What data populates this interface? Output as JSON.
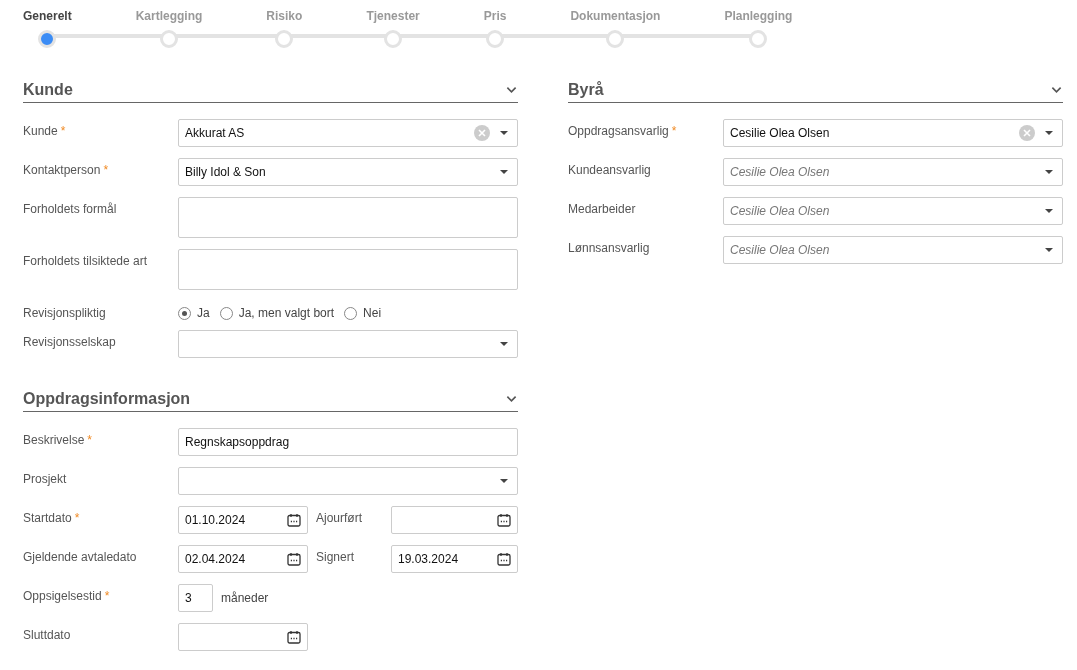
{
  "steps": [
    {
      "label": "Generelt",
      "selected": true
    },
    {
      "label": "Kartlegging",
      "selected": false
    },
    {
      "label": "Risiko",
      "selected": false
    },
    {
      "label": "Tjenester",
      "selected": false
    },
    {
      "label": "Pris",
      "selected": false
    },
    {
      "label": "Dokumentasjon",
      "selected": false
    },
    {
      "label": "Planlegging",
      "selected": false
    }
  ],
  "left_column": {
    "sections": [
      {
        "title": "Kunde",
        "fields": [
          {
            "kind": "select",
            "label": "Kunde",
            "mark": "*",
            "value": "Akkurat AS",
            "clearable": true
          },
          {
            "kind": "select",
            "label": "Kontaktperson",
            "mark": "*",
            "value": "Billy Idol & Son",
            "clearable": false
          },
          {
            "kind": "textarea",
            "label": "Forholdets formål"
          },
          {
            "kind": "textarea",
            "label": "Forholdets tilsiktede art"
          },
          {
            "kind": "radio",
            "label": "Revisjonspliktig",
            "options": [
              {
                "label": "Ja",
                "selected": true
              },
              {
                "label": "Ja, men valgt bort",
                "selected": false
              },
              {
                "label": "Nei",
                "selected": false
              }
            ]
          },
          {
            "kind": "select",
            "label": "Revisjonsselskap",
            "clearable": false
          }
        ]
      },
      {
        "title": "Oppdragsinformasjon",
        "fields": [
          {
            "kind": "text",
            "label": "Beskrivelse",
            "mark": "*",
            "value": "Regnskapsoppdrag"
          },
          {
            "kind": "select",
            "label": "Prosjekt",
            "clearable": false
          },
          {
            "kind": "date",
            "label": "Startdato",
            "mark": "*",
            "value": "01.10.2024",
            "side": {
              "label": "Ajourført"
            }
          },
          {
            "kind": "date",
            "label": "Gjeldende avtaledato",
            "value": "02.04.2024",
            "side": {
              "label": "Signert",
              "value": "19.03.2024"
            }
          },
          {
            "kind": "number",
            "label": "Oppsigelsestid",
            "mark": "*",
            "value": "3",
            "unit": "måneder"
          },
          {
            "kind": "date",
            "label": "Sluttdato"
          }
        ]
      }
    ]
  },
  "right_column": {
    "sections": [
      {
        "title": "Byrå",
        "fields": [
          {
            "kind": "select",
            "label": "Oppdragsansvarlig",
            "mark": "*",
            "value": "Cesilie Olea Olsen",
            "clearable": true
          },
          {
            "kind": "select",
            "label": "Kundeansvarlig",
            "placeholder": "Cesilie Olea Olsen",
            "clearable": false
          },
          {
            "kind": "select",
            "label": "Medarbeider",
            "placeholder": "Cesilie Olea Olsen",
            "clearable": false
          },
          {
            "kind": "select",
            "label": "Lønnsansvarlig",
            "placeholder": "Cesilie Olea Olsen",
            "clearable": false
          }
        ]
      }
    ]
  }
}
